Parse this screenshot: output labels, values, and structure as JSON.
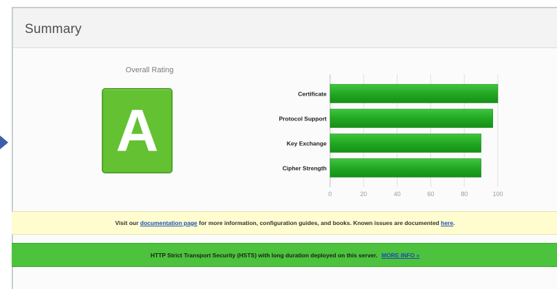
{
  "panel": {
    "title": "Summary"
  },
  "rating": {
    "label": "Overall Rating",
    "grade": "A"
  },
  "chart_data": {
    "type": "bar",
    "orientation": "horizontal",
    "categories": [
      "Certificate",
      "Protocol Support",
      "Key Exchange",
      "Cipher Strength"
    ],
    "values": [
      100,
      97,
      90,
      90
    ],
    "xlim": [
      0,
      100
    ],
    "ticks": [
      0,
      20,
      40,
      60,
      80,
      100
    ],
    "grid": true,
    "bar_color": "#2ca82c"
  },
  "notices": {
    "doc": {
      "prefix": "Visit our",
      "link1": "documentation page",
      "middle": "for more information, configuration guides, and books. Known issues are documented",
      "link2": "here",
      "suffix": "."
    },
    "hsts": {
      "text": "HTTP Strict Transport Security (HSTS) with long duration deployed on this server.",
      "link": "MORE INFO »"
    }
  }
}
